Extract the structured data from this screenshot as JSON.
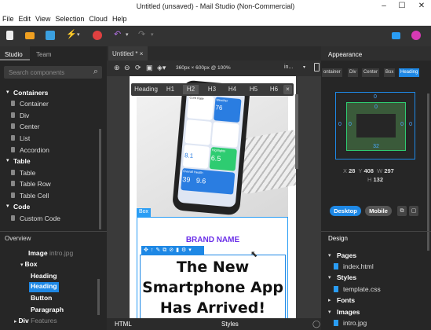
{
  "window": {
    "title": "Untitled (unsaved) - Mail Studio (Non-Commercial)",
    "minimize": "–",
    "maximize": "☐",
    "close": "✕"
  },
  "menu": [
    "File",
    "Edit",
    "View",
    "Selection",
    "Cloud",
    "Help"
  ],
  "left_panel": {
    "tabs": [
      "Studio",
      "Team"
    ],
    "search_placeholder": "Search components",
    "tree": [
      {
        "label": "Containers",
        "type": "section"
      },
      {
        "label": "Container",
        "type": "item"
      },
      {
        "label": "Div",
        "type": "item"
      },
      {
        "label": "Center",
        "type": "item"
      },
      {
        "label": "List",
        "type": "item"
      },
      {
        "label": "Accordion",
        "type": "item"
      },
      {
        "label": "Table",
        "type": "section"
      },
      {
        "label": "Table",
        "type": "item"
      },
      {
        "label": "Table Row",
        "type": "item"
      },
      {
        "label": "Table Cell",
        "type": "item"
      },
      {
        "label": "Code",
        "type": "section"
      },
      {
        "label": "Custom Code",
        "type": "item"
      }
    ]
  },
  "overview": {
    "title": "Overview",
    "items": [
      {
        "label": "Image",
        "extra": "intro.jpg"
      },
      {
        "label": "Box",
        "extra": ""
      },
      {
        "label": "Heading",
        "extra": ""
      },
      {
        "label": "Heading",
        "extra": ""
      },
      {
        "label": "Button",
        "extra": ""
      },
      {
        "label": "Paragraph",
        "extra": ""
      },
      {
        "label": "Div",
        "extra": "Features"
      }
    ]
  },
  "center": {
    "tab_label": "Untitled *",
    "tab_close": "×",
    "size_label": "360px × 600px @ 100%",
    "dropdown_label": "in...",
    "heading_bar": {
      "title": "Heading",
      "levels": [
        "H1",
        "H2",
        "H3",
        "H4",
        "H5",
        "H6"
      ],
      "close": "×"
    },
    "box_label": "Box",
    "brand": "BRAND NAME",
    "headline": [
      "The New",
      "Smartphone App",
      "Has Arrived!"
    ],
    "bottom_tabs": [
      "HTML",
      "Styles"
    ]
  },
  "right_panel": {
    "appearance_title": "Appearance",
    "element_tabs": [
      "ontainer",
      "Div",
      "Center",
      "Box",
      "Heading"
    ],
    "box_model": {
      "margin_top": "0",
      "padding_top": "0",
      "left_outer": "0",
      "left_inner": "0",
      "right_inner": "0",
      "right_outer": "0",
      "bottom": "32"
    },
    "geometry": {
      "x_label": "X",
      "x": "28",
      "y_label": "Y",
      "y": "408",
      "w_label": "W",
      "w": "297",
      "h_label": "H",
      "h": "132"
    },
    "view_buttons": [
      "Desktop",
      "Mobile"
    ],
    "design_title": "Design",
    "design_tree": [
      {
        "label": "Pages",
        "type": "section"
      },
      {
        "label": "index.html",
        "type": "file"
      },
      {
        "label": "Styles",
        "type": "section"
      },
      {
        "label": "template.css",
        "type": "file"
      },
      {
        "label": "Fonts",
        "type": "section"
      },
      {
        "label": "Images",
        "type": "section"
      },
      {
        "label": "intro.jpg",
        "type": "file"
      }
    ]
  },
  "phone_screen": {
    "rows": [
      "Core Rate",
      "Weather",
      "",
      "Highlights",
      "",
      "Overall Health"
    ],
    "values": [
      "6.5",
      "39",
      "9.6"
    ],
    "small": [
      "76",
      "8.1"
    ]
  },
  "colors": {
    "accent": "#1e88e5",
    "brand_purple": "#6a2ee8",
    "heading_blue": "#2a7de1"
  }
}
